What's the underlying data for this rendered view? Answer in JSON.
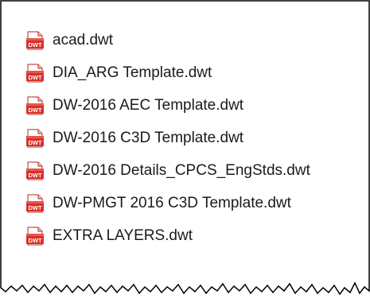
{
  "files": [
    {
      "name": "acad.dwt",
      "icon": "dwt-file-icon"
    },
    {
      "name": "DIA_ARG Template.dwt",
      "icon": "dwt-file-icon"
    },
    {
      "name": "DW-2016 AEC Template.dwt",
      "icon": "dwt-file-icon"
    },
    {
      "name": "DW-2016 C3D Template.dwt",
      "icon": "dwt-file-icon"
    },
    {
      "name": "DW-2016 Details_CPCS_EngStds.dwt",
      "icon": "dwt-file-icon"
    },
    {
      "name": "DW-PMGT 2016 C3D Template.dwt",
      "icon": "dwt-file-icon"
    },
    {
      "name": "EXTRA LAYERS.dwt",
      "icon": "dwt-file-icon"
    }
  ],
  "icon_label": "DWT",
  "colors": {
    "icon_red": "#d9302b",
    "icon_dark_red": "#9e1c18",
    "frame_border": "#000000"
  }
}
